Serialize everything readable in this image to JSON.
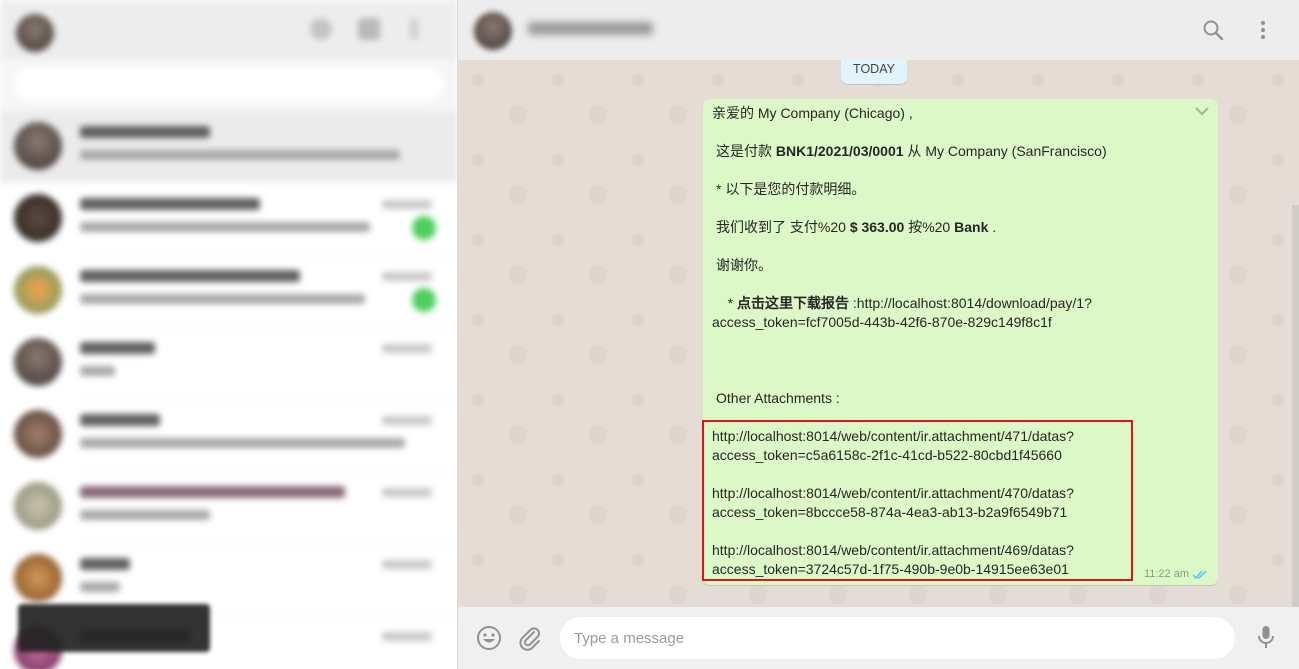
{
  "app": {
    "accent": "#4fce5d",
    "bubble_color": "#dcf8c6",
    "highlight_color": "#e0141e"
  },
  "left_panel": {
    "header_icons": [
      "status-icon",
      "new-chat-icon",
      "menu-icon"
    ],
    "chats_count_visible": 8
  },
  "chat_header": {
    "contact_name": "",
    "icons": [
      "search-icon",
      "menu-icon"
    ]
  },
  "conversation": {
    "date_divider": "TODAY",
    "message": {
      "greeting": "亲爱的 My Company (Chicago) ,",
      "payment_prefix": "这是付款 ",
      "payment_ref": "BNK1/2021/03/0001",
      "payment_suffix": " 从 My Company (SanFrancisco)",
      "details_line": " * 以下是您的付款明细。",
      "received_prefix": "我们收到了 支付%20 ",
      "amount": "$ 363.00",
      "received_mid": " 按%20 ",
      "bank": "Bank",
      "received_suffix": " .",
      "thanks": "谢谢你。",
      "download_bullet": "   * ",
      "download_label": "点击这里下载报告",
      "download_url_a": " :http://localhost:8014/download/pay/1?",
      "download_url_b": "access_token=fcf7005d-443b-42f6-870e-829c149f8c1f",
      "attachments_label": "Other Attachments :",
      "attachments": [
        {
          "url": "http://localhost:8014/web/content/ir.attachment/471/datas?",
          "token": "access_token=c5a6158c-2f1c-41cd-b522-80cbd1f45660"
        },
        {
          "url": "http://localhost:8014/web/content/ir.attachment/470/datas?",
          "token": "access_token=8bccce58-874a-4ea3-ab13-b2a9f6549b71"
        },
        {
          "url": "http://localhost:8014/web/content/ir.attachment/469/datas?",
          "token": "access_token=3724c57d-1f75-490b-9e0b-14915ee63e01"
        }
      ],
      "time": "11:22 am",
      "status": "read"
    }
  },
  "composer": {
    "placeholder": "Type a message",
    "icons": [
      "emoji-icon",
      "attach-icon",
      "mic-icon"
    ]
  }
}
